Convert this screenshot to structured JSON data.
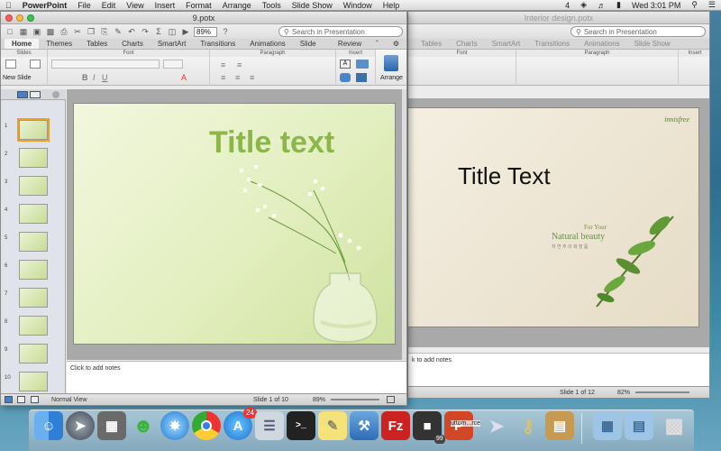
{
  "menubar": {
    "apple": "",
    "app_name": "PowerPoint",
    "items": [
      "File",
      "Edit",
      "View",
      "Insert",
      "Format",
      "Arrange",
      "Tools",
      "Slide Show",
      "Window",
      "Help"
    ],
    "clock": "Wed 3:01 PM",
    "status_4": "4"
  },
  "window_front": {
    "title": "9.potx",
    "zoom": "89%",
    "search_placeholder": "Search in Presentation",
    "tabs": [
      "Home",
      "Themes",
      "Tables",
      "Charts",
      "SmartArt",
      "Transitions",
      "Animations",
      "Slide Show",
      "Review"
    ],
    "groups": {
      "slides": "Slides",
      "font": "Font",
      "paragraph": "Paragraph",
      "insert": "Insert"
    },
    "new_slide": "New Slide",
    "arrange": "Arrange",
    "slide_numbers": [
      "1",
      "2",
      "3",
      "4",
      "5",
      "6",
      "7",
      "8",
      "9",
      "10"
    ],
    "slide_title": "Title text",
    "notes": "Click to add notes",
    "status": {
      "view": "Normal View",
      "slide": "Slide 1 of 10",
      "zoom": "89%"
    }
  },
  "window_back": {
    "title": "Interior design.potx",
    "search_placeholder": "Search in Presentation",
    "tabs": [
      "Tables",
      "Charts",
      "SmartArt",
      "Transitions",
      "Animations",
      "Slide Show"
    ],
    "groups": {
      "font": "Font",
      "paragraph": "Paragraph",
      "insert": "Insert"
    },
    "brand": "innisfree",
    "slide_title": "Title Text",
    "tagline1": "For Your",
    "tagline2": "Natural beauty",
    "tagline3": "자 연 주 의 화 장 품",
    "notes": "k to add notes",
    "status": {
      "slide": "Slide 1 of 12",
      "zoom": "82%"
    }
  },
  "dock": {
    "appstore_badge": "24",
    "badge_99": "99",
    "ppt_partial_label": "uttom...rce"
  },
  "colors": {
    "accent": "#f0a020",
    "slide_title_green": "#8cb54a"
  }
}
